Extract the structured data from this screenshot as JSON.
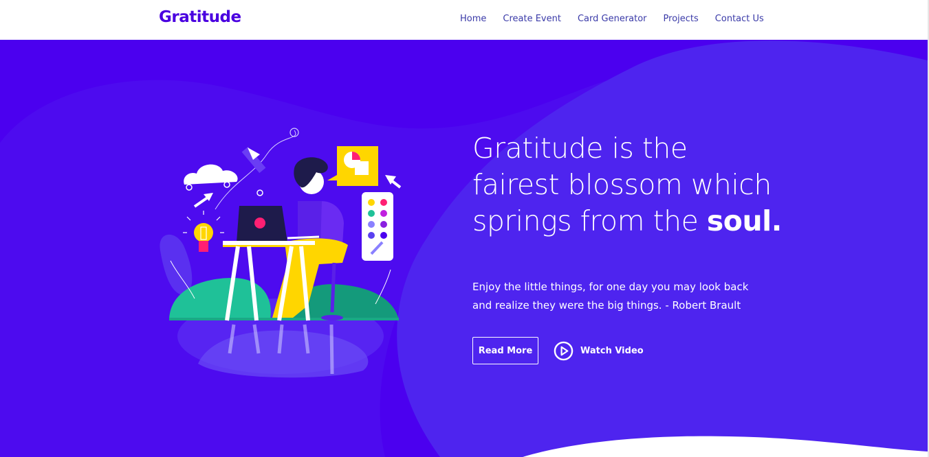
{
  "nav": {
    "brand": "Gratitude",
    "links": [
      "Home",
      "Create Event",
      "Card Generator",
      "Projects",
      "Contact Us"
    ]
  },
  "hero": {
    "headline_light": "Gratitude is the fairest blossom which springs from the ",
    "headline_bold": "soul.",
    "quote": "Enjoy the little things, for one day you may look back and realize they were the big things. - Robert Brault",
    "read_more_label": "Read More",
    "watch_video_label": "Watch Video"
  },
  "icons": {
    "play": "play-circle-icon",
    "illustration": "person-at-laptop-illustration"
  },
  "colors": {
    "brand": "#4a00e0",
    "hero_background": "#4b00ef",
    "nav_link": "#3a3aa8",
    "accent_yellow": "#ffd600",
    "accent_green": "#1fc198",
    "accent_pink": "#ff1f73"
  }
}
